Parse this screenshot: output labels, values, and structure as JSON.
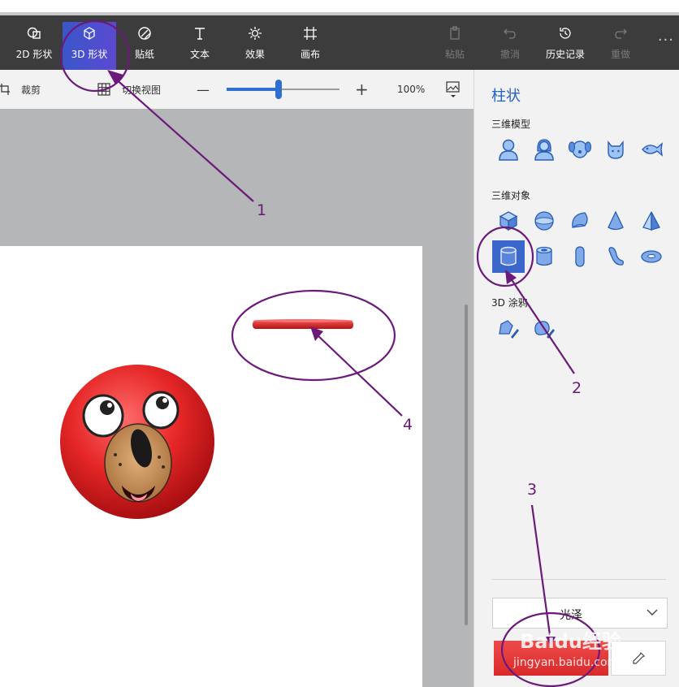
{
  "ribbon": {
    "tools": [
      {
        "label": "2D 形状",
        "icon": "2d-shapes-icon"
      },
      {
        "label": "3D 形状",
        "icon": "3d-shapes-icon"
      },
      {
        "label": "贴纸",
        "icon": "sticker-icon"
      },
      {
        "label": "文本",
        "icon": "text-icon"
      },
      {
        "label": "效果",
        "icon": "effects-icon"
      },
      {
        "label": "画布",
        "icon": "canvas-icon"
      }
    ],
    "actions": [
      {
        "label": "粘贴",
        "icon": "paste-icon"
      },
      {
        "label": "撤消",
        "icon": "undo-icon"
      },
      {
        "label": "历史记录",
        "icon": "history-icon"
      },
      {
        "label": "重做",
        "icon": "redo-icon"
      }
    ],
    "more": "···"
  },
  "subbar": {
    "crop_label": "裁剪",
    "switch_view_label": "切换视图",
    "zoom_minus": "—",
    "zoom_plus": "+",
    "zoom_value": "100%",
    "zoom_level": 0.46
  },
  "panel": {
    "title": "柱状",
    "section_models": "三维模型",
    "section_objects": "三维对象",
    "section_doodle": "3D 涂鸦",
    "material_value": "光泽",
    "selected_color": "#d92a2a"
  },
  "annotations": {
    "n1": "1",
    "n2": "2",
    "n3": "3",
    "n4": "4"
  },
  "watermark": {
    "main": "Baidu经验",
    "url": "jingyan.baidu.com"
  }
}
